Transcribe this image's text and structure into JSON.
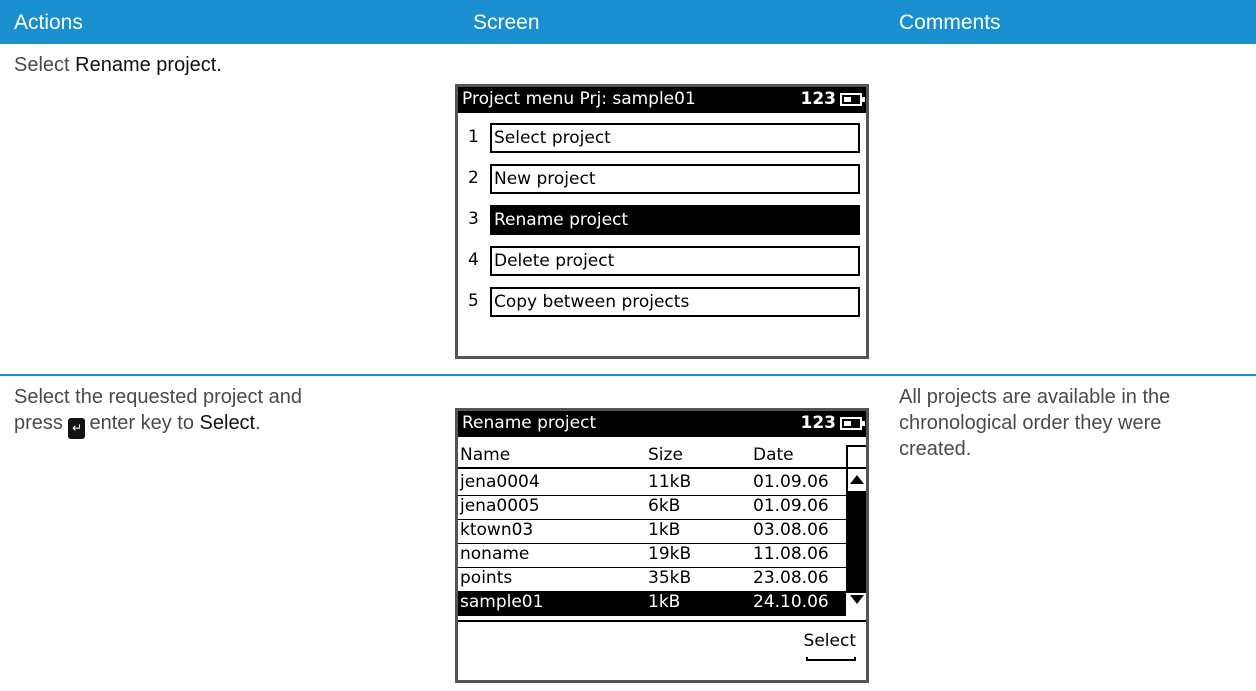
{
  "header": {
    "actions": "Actions",
    "screen": "Screen",
    "comments": "Comments"
  },
  "row1": {
    "action_prefix": "Select ",
    "action_bold": "Rename project."
  },
  "screen1": {
    "title": "Project menu  Prj: sample01",
    "indicator": "123",
    "items": [
      {
        "num": "1",
        "label": "Select project"
      },
      {
        "num": "2",
        "label": "New project"
      },
      {
        "num": "3",
        "label": "Rename project"
      },
      {
        "num": "4",
        "label": "Delete project"
      },
      {
        "num": "5",
        "label": "Copy between projects"
      }
    ],
    "selected_index": 2
  },
  "row2": {
    "action_line1": "Select the requested project and",
    "action_press": "press",
    "enter_glyph": "↵",
    "action_mid": "enter key to ",
    "action_bold": "Select",
    "action_end": ".",
    "comment": "All projects are available in the chronological order they were created."
  },
  "screen2": {
    "title": "Rename project",
    "indicator": "123",
    "columns": [
      "Name",
      "Size",
      "Date"
    ],
    "rows": [
      [
        "jena0004",
        "11kB",
        "01.09.06"
      ],
      [
        "jena0005",
        "6kB",
        "01.09.06"
      ],
      [
        "ktown03",
        "1kB",
        "03.08.06"
      ],
      [
        "noname",
        "19kB",
        "11.08.06"
      ],
      [
        "points",
        "35kB",
        "23.08.06"
      ],
      [
        "sample01",
        "1kB",
        "24.10.06"
      ]
    ],
    "selected_index": 5,
    "softkey": "Select"
  },
  "icons": {
    "battery": "battery-icon",
    "enter": "enter-key-icon",
    "scroll_up": "arrow-up-icon",
    "scroll_down": "arrow-down-icon"
  }
}
